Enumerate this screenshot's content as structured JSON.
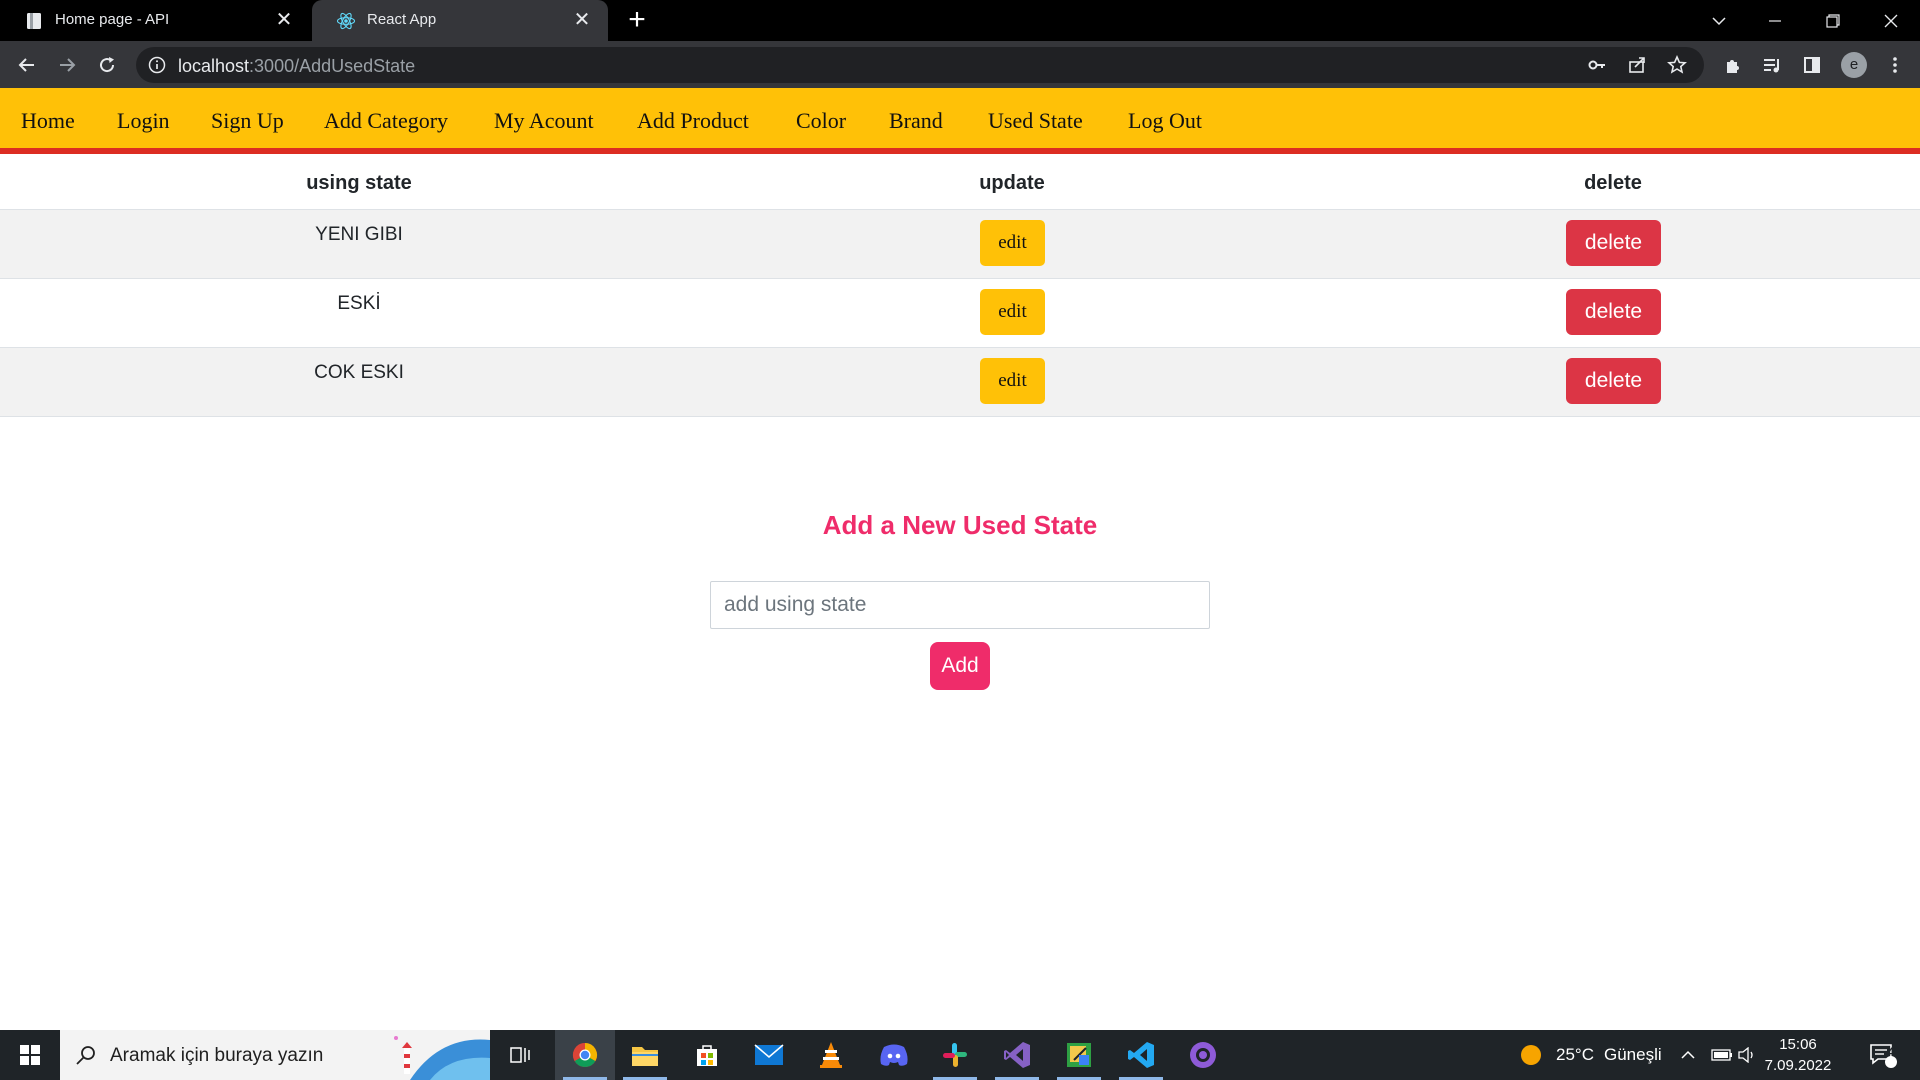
{
  "browser": {
    "tabs": [
      {
        "title": "Home page - API",
        "active": false
      },
      {
        "title": "React App",
        "active": true
      }
    ],
    "url_host": "localhost",
    "url_rest": ":3000/AddUsedState"
  },
  "profile_initial": "e",
  "nav": {
    "items": [
      "Home",
      "Login",
      "Sign Up",
      "Add Category",
      "My Acount",
      "Add Product",
      "Color",
      "Brand",
      "Used State",
      "Log Out"
    ]
  },
  "table": {
    "headers": {
      "state": "using state",
      "update": "update",
      "delete": "delete"
    },
    "rows": [
      {
        "state": "YENI GIBI",
        "edit": "edit",
        "delete": "delete"
      },
      {
        "state": "ESKİ",
        "edit": "edit",
        "delete": "delete"
      },
      {
        "state": "COK ESKI",
        "edit": "edit",
        "delete": "delete"
      }
    ]
  },
  "form": {
    "title": "Add a New Used State",
    "placeholder": "add using state",
    "button": "Add"
  },
  "taskbar": {
    "search_placeholder": "Aramak için buraya yazın",
    "weather_temp": "25°C",
    "weather_desc": "Güneşli",
    "time": "15:06",
    "date": "7.09.2022",
    "notification_count": "4"
  },
  "colors": {
    "nav_bg": "#ffc107",
    "nav_border": "#dc2d22",
    "edit_btn": "#ffc107",
    "delete_btn": "#dc3545",
    "accent": "#ef2c6a"
  }
}
